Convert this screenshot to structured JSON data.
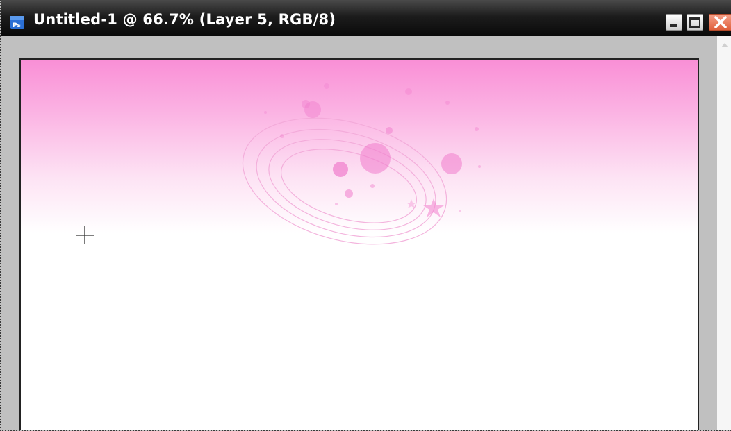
{
  "window": {
    "title": "Untitled-1 @ 66.7% (Layer 5, RGB/8)",
    "app_icon": "photoshop-icon",
    "controls": {
      "minimize_icon": "minimize-icon",
      "maximize_icon": "maximize-icon",
      "close_icon": "close-icon"
    }
  },
  "colors": {
    "canvas_gradient_top": "#f98fd6",
    "canvas_gradient_bottom": "#ffffff",
    "ornament_pink": "#f06cc8",
    "pasteboard": "#c0c0c0",
    "titlebar": "#1c1c1c"
  },
  "canvas": {
    "cursor_icon": "crosshair-cursor-icon"
  }
}
